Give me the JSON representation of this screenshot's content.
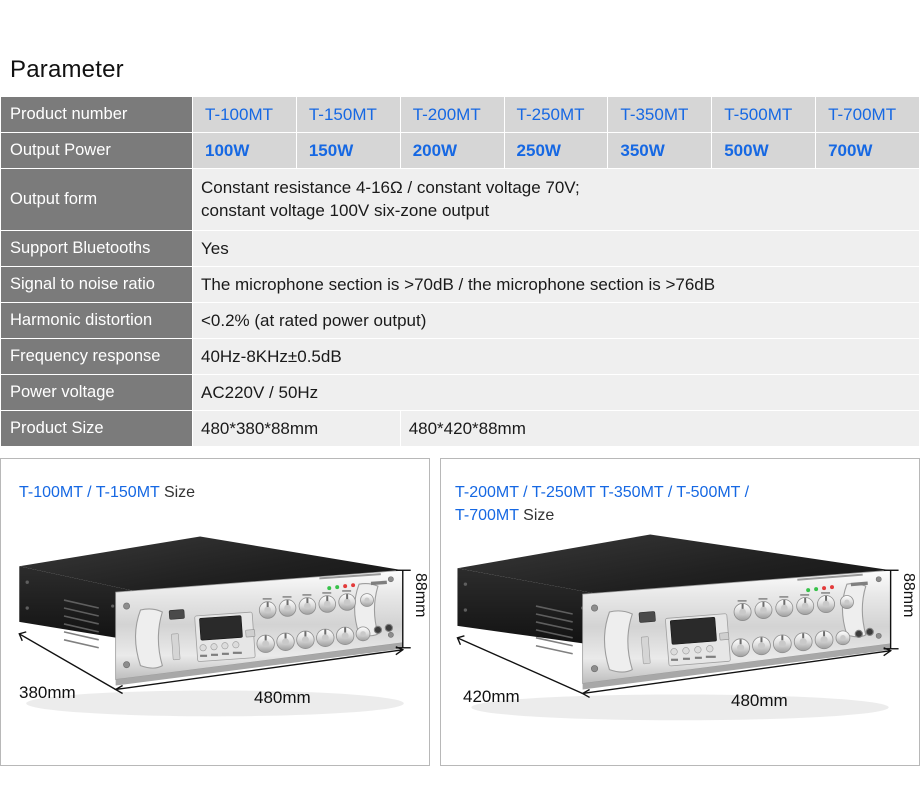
{
  "page": {
    "title": "Parameter",
    "accent_blue": "#1668e3",
    "label_gray": "#7b7b7b",
    "value_gray": "#e2e2e2"
  },
  "spec_table": {
    "rows": [
      {
        "label": "Product number",
        "type": "models",
        "cells": [
          "T-100MT",
          "T-150MT",
          "T-200MT",
          "T-250MT",
          "T-350MT",
          "T-500MT",
          "T-700MT"
        ]
      },
      {
        "label": "Output Power",
        "type": "power",
        "cells": [
          "100W",
          "150W",
          "200W",
          "250W",
          "350W",
          "500W",
          "700W"
        ]
      },
      {
        "label": "Output form",
        "type": "span-two-line",
        "line1": "Constant resistance 4-16Ω / constant voltage 70V;",
        "line2": "constant voltage 100V six-zone output"
      },
      {
        "label": "Support Bluetooths",
        "type": "span",
        "value": "Yes"
      },
      {
        "label": "Signal to noise ratio",
        "type": "span",
        "value": "The microphone section is >70dB / the microphone section is >76dB"
      },
      {
        "label": "Harmonic distortion",
        "type": "span",
        "value": "<0.2% (at rated power output)"
      },
      {
        "label": "Frequency response",
        "type": "span",
        "value": "40Hz-8KHz±0.5dB"
      },
      {
        "label": "Power voltage",
        "type": "span",
        "value": "AC220V / 50Hz"
      },
      {
        "label": "Product Size",
        "type": "split",
        "value_a": "480*380*88mm",
        "value_b": "480*420*88mm"
      }
    ]
  },
  "panels": {
    "left": {
      "title_models": "T-100MT / T-150MT",
      "title_suffix": " Size",
      "dim_depth": "380mm",
      "dim_width": "480mm",
      "dim_height": "88mm"
    },
    "right": {
      "title_models_line1": "T-200MT / T-250MT T-350MT / T-500MT /",
      "title_models_line2": "T-700MT",
      "title_suffix": " Size",
      "dim_depth": "420mm",
      "dim_width": "480mm",
      "dim_height": "88mm"
    }
  }
}
